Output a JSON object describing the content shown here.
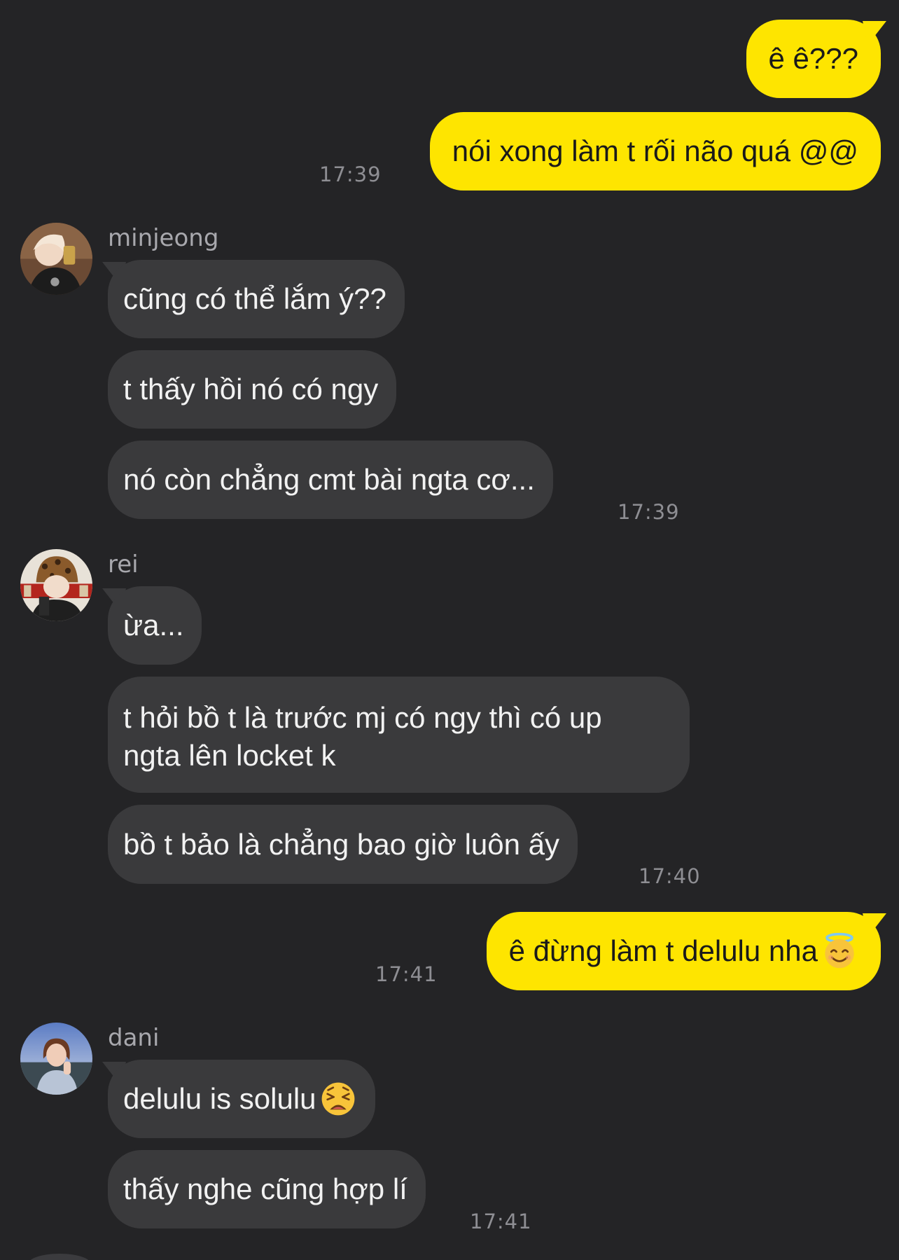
{
  "conversation": {
    "messages": [
      {
        "direction": "outgoing",
        "text": "ê ê???"
      },
      {
        "direction": "outgoing",
        "text": "nói xong làm t rối não quá @@",
        "time": "17:39"
      },
      {
        "direction": "incoming",
        "sender": "minjeong",
        "text": "cũng có thể lắm ý??"
      },
      {
        "direction": "incoming",
        "sender": "minjeong",
        "text": "t thấy hồi nó có ngy"
      },
      {
        "direction": "incoming",
        "sender": "minjeong",
        "text": "nó còn chẳng cmt bài ngta cơ...",
        "time": "17:39"
      },
      {
        "direction": "incoming",
        "sender": "rei",
        "text": "ừa..."
      },
      {
        "direction": "incoming",
        "sender": "rei",
        "line1": "t hỏi bồ t là trước mj có ngy thì có up",
        "line2": "ngta lên locket k"
      },
      {
        "direction": "incoming",
        "sender": "rei",
        "text": "bồ t bảo là chẳng bao giờ luôn ấy",
        "time": "17:40"
      },
      {
        "direction": "outgoing",
        "text": "ê đừng làm t delulu nha",
        "emoji": "smiling-face-with-halo",
        "time": "17:41"
      },
      {
        "direction": "incoming",
        "sender": "dani",
        "text": "delulu is solulu",
        "emoji": "weary-face"
      },
      {
        "direction": "incoming",
        "sender": "dani",
        "text": "thấy nghe cũng hợp lí",
        "time": "17:41"
      }
    ]
  },
  "senders": {
    "minjeong": {
      "name": "minjeong",
      "avatar_icon": "avatar-minjeong"
    },
    "rei": {
      "name": "rei",
      "avatar_icon": "avatar-rei"
    },
    "dani": {
      "name": "dani",
      "avatar_icon": "avatar-dani"
    }
  },
  "colors": {
    "background": "#242426",
    "outgoing_bubble": "#fee500",
    "incoming_bubble": "#3a3a3c",
    "timestamp": "#8e8e93"
  }
}
